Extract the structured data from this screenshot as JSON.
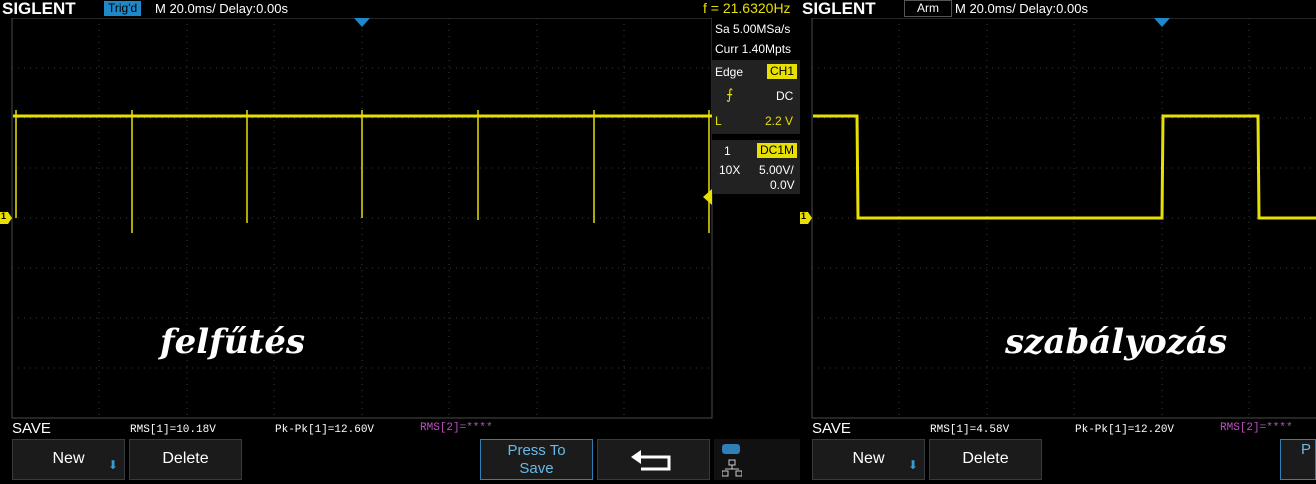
{
  "left_screen": {
    "brand": "SIGLENT",
    "trigger_status": "Trig'd",
    "timebase": "M 20.0ms/ Delay:0.00s",
    "frequency": "f = 21.6320Hz",
    "overlay_label": "felfűtés",
    "channel_marker": "1",
    "side_panel": {
      "sample_rate": "Sa 5.00MSa/s",
      "memory": "Curr 1.40Mpts",
      "trigger_type": "Edge",
      "trigger_source": "CH1",
      "coupling": "DC",
      "level_label": "L",
      "level_value": "2.2 V",
      "channel_num": "1",
      "channel_coupling": "DC1M",
      "probe": "10X",
      "volts_div": "5.00V/",
      "offset": "0.0V"
    },
    "save_label": "SAVE",
    "measurements": {
      "rms1": "RMS[1]=10.18V",
      "pkpk1": "Pk-Pk[1]=12.60V",
      "rms2": "RMS[2]=****"
    },
    "buttons": {
      "new": "New",
      "delete": "Delete",
      "press_to_save_line1": "Press To",
      "press_to_save_line2": "Save"
    },
    "colors": {
      "trace": "#e8e000",
      "accent": "#1e88c8",
      "measure2": "#c050c0"
    }
  },
  "right_screen": {
    "brand": "SIGLENT",
    "trigger_status": "Arm",
    "timebase": "M 20.0ms/ Delay:0.00s",
    "overlay_label": "szabályozás",
    "channel_marker": "1",
    "save_label": "SAVE",
    "measurements": {
      "rms1": "RMS[1]=4.58V",
      "pkpk1": "Pk-Pk[1]=12.20V",
      "rms2": "RMS[2]=****"
    },
    "buttons": {
      "new": "New",
      "delete": "Delete",
      "partial": "P"
    }
  }
}
